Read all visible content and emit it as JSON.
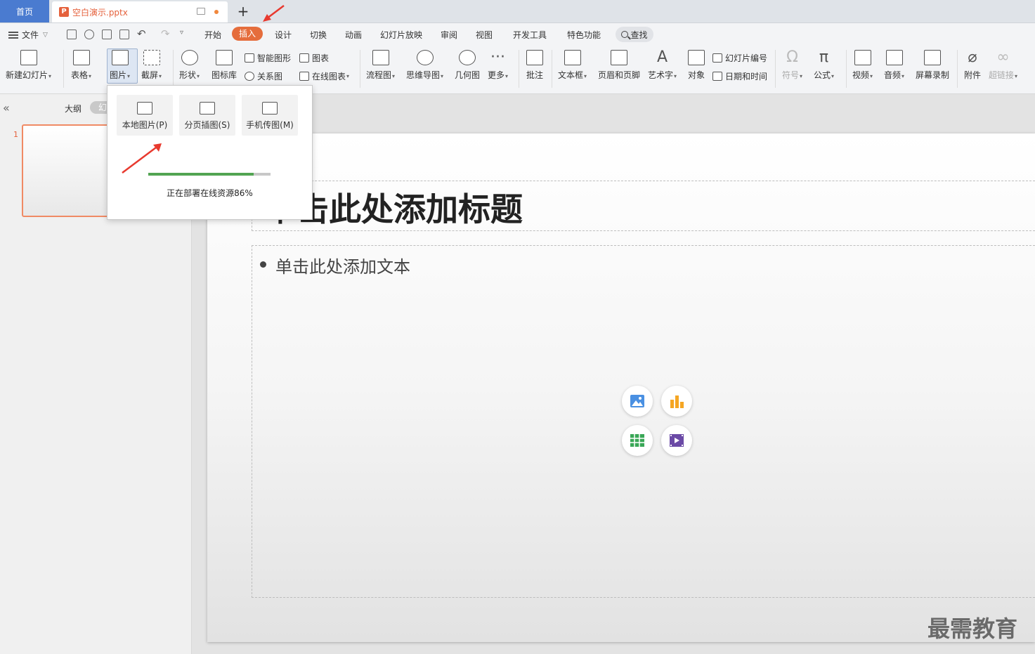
{
  "tabs": {
    "home": "首页",
    "document": "空白演示.pptx",
    "new_tab": "+"
  },
  "menu": {
    "file": "文件",
    "tabs": [
      "开始",
      "插入",
      "设计",
      "切换",
      "动画",
      "幻灯片放映",
      "审阅",
      "视图",
      "开发工具",
      "特色功能"
    ],
    "active_tab": "插入",
    "search": "查找"
  },
  "ribbon": {
    "new_slide": "新建幻灯片",
    "table": "表格",
    "picture": "图片",
    "screenshot": "截屏",
    "shape": "形状",
    "icon_lib": "图标库",
    "smart_art": "智能图形",
    "chart": "图表",
    "relation": "关系图",
    "online_chart": "在线图表",
    "flowchart": "流程图",
    "mindmap": "思维导图",
    "geometry": "几何图",
    "more": "更多",
    "comment": "批注",
    "textbox": "文本框",
    "header_footer": "页眉和页脚",
    "wordart": "艺术字",
    "object": "对象",
    "slide_number": "幻灯片编号",
    "datetime": "日期和时间",
    "symbol": "符号",
    "formula": "公式",
    "video": "视频",
    "audio": "音频",
    "screen_record": "屏幕录制",
    "attachment": "附件",
    "hyperlink": "超链接"
  },
  "left_panel": {
    "outline": "大纲",
    "slides": "幻",
    "slide_number": "1"
  },
  "slide": {
    "title": "单击此处添加标题",
    "body": "单击此处添加文本"
  },
  "dropdown": {
    "items": [
      {
        "label": "本地图片(P)"
      },
      {
        "label": "分页插图(S)"
      },
      {
        "label": "手机传图(M)"
      }
    ],
    "progress": 0.86,
    "progress_text": "正在部署在线资源86%"
  },
  "watermark": "最需教育",
  "colors": {
    "accent": "#e56d3c",
    "home_tab": "#4a7bd0",
    "progress": "#52a452",
    "annotation_arrow": "#e8392e"
  }
}
